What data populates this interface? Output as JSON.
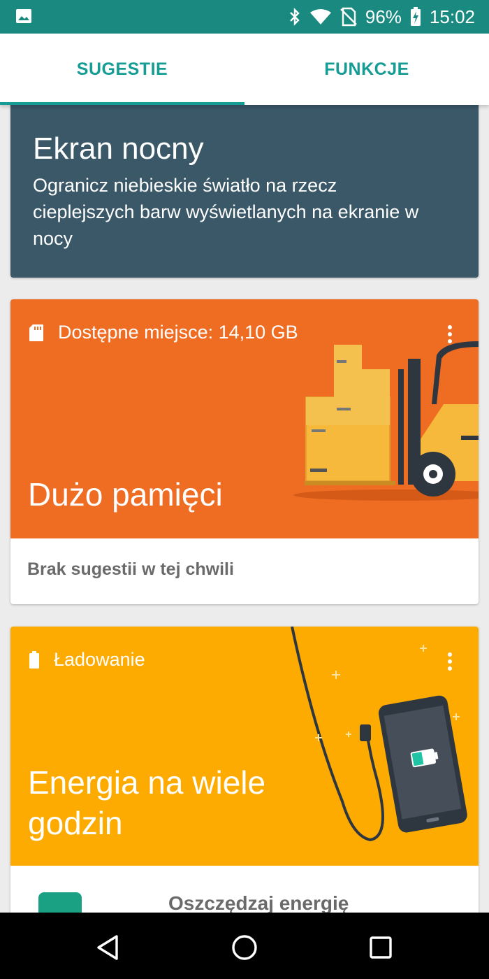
{
  "status_bar": {
    "battery_percent": "96%",
    "time": "15:02",
    "icons": [
      "image-icon",
      "bluetooth-icon",
      "wifi-icon",
      "no-sim-icon",
      "battery-charging-icon"
    ]
  },
  "tabs": [
    {
      "label": "SUGESTIE",
      "selected": true
    },
    {
      "label": "FUNKCJE",
      "selected": false
    }
  ],
  "night_card": {
    "title": "Ekran nocny",
    "description": "Ogranicz niebieskie światło na rzecz cieplejszych barw wyświetlanych na ekranie w nocy"
  },
  "storage_card": {
    "label": "Dostępne miejsce: 14,10  GB",
    "title": "Dużo pamięci",
    "footer": "Brak sugestii w tej chwili"
  },
  "charge_card": {
    "label": "Ładowanie",
    "title": "Energia na wiele godzin",
    "item": "Oszczędzaj energię"
  },
  "colors": {
    "accent": "#149c95",
    "status_bar": "#1a8a80",
    "night_card": "#3a5868",
    "storage_hero": "#ef6c23",
    "charge_hero": "#fdab00"
  }
}
